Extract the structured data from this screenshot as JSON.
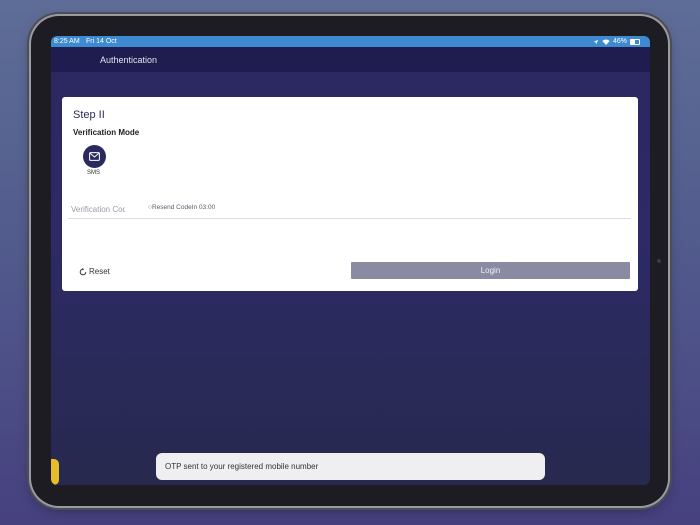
{
  "status_bar": {
    "time": "8:25 AM",
    "date": "Fri 14 Oct",
    "battery": "46%"
  },
  "header": {
    "title": "Authentication"
  },
  "card": {
    "step_title": "Step II",
    "verification_mode_label": "Verification Mode",
    "modes": [
      {
        "name": "SMS",
        "icon": "mail-icon",
        "selected": true
      }
    ],
    "code_field": {
      "placeholder": "Verification Cod",
      "value": ""
    },
    "resend_text": "Resend CodeIn 03:00",
    "reset_label": "Reset",
    "login_label": "Login"
  },
  "toast": {
    "message": "OTP sent to your registered mobile number"
  },
  "colors": {
    "primary": "#2b2a5e",
    "status_bar": "#3d8ad0",
    "button_disabled": "#8a8aa2",
    "accent": "#e8bd2a"
  }
}
